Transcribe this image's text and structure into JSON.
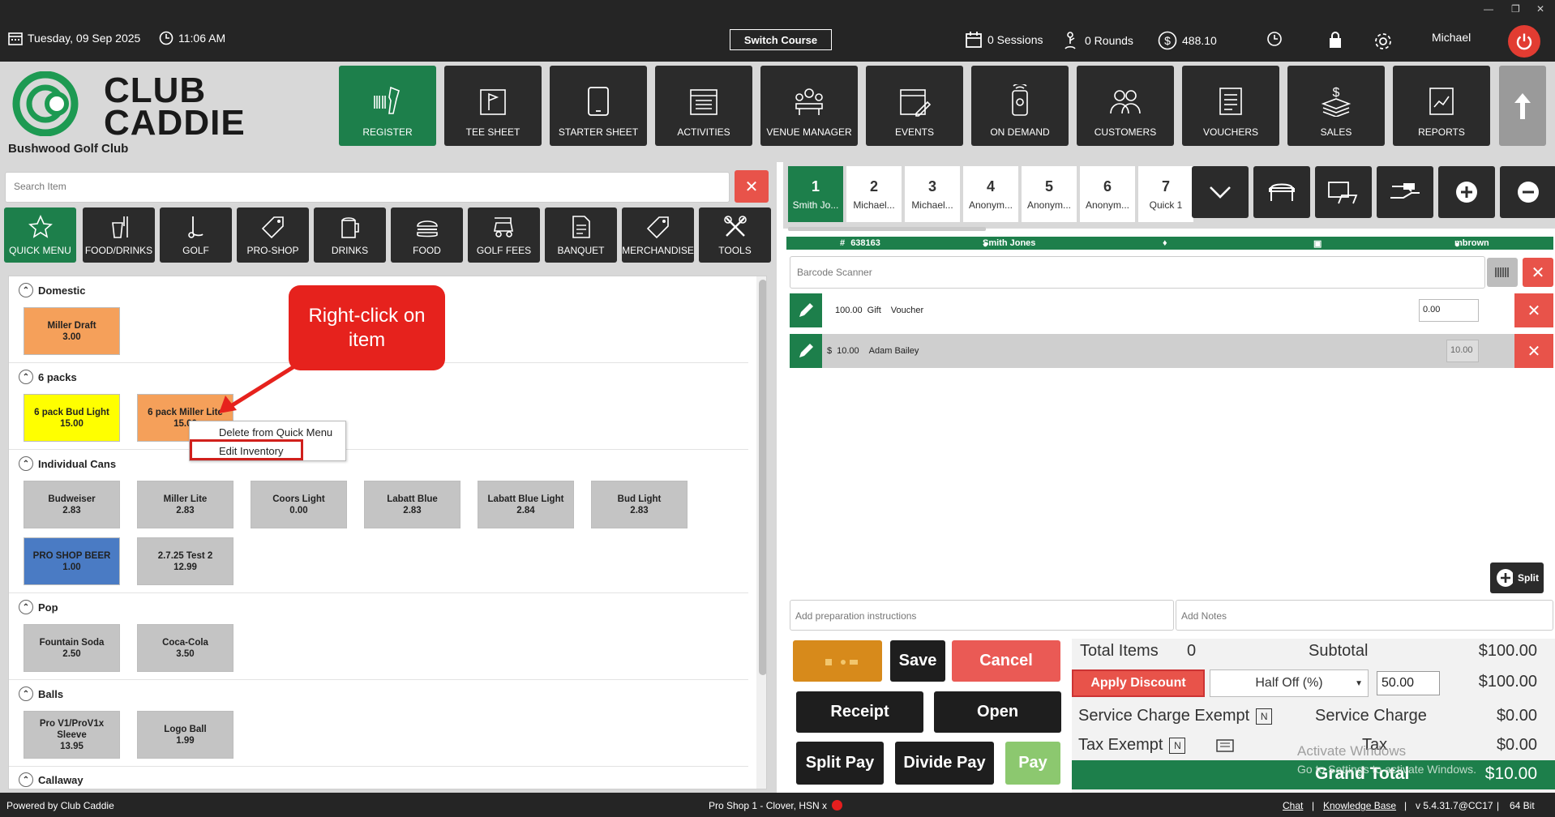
{
  "topbar": {
    "date": "Tuesday,  09 Sep 2025",
    "time": "11:06 AM",
    "switch_course": "Switch Course",
    "sessions": "0 Sessions",
    "rounds": "0 Rounds",
    "balance": "488.10",
    "user": "Michael"
  },
  "brand": {
    "logo_line1": "CLUB",
    "logo_line2": "CADDIE",
    "club_name": "Bushwood Golf Club"
  },
  "nav": [
    "REGISTER",
    "TEE SHEET",
    "STARTER SHEET",
    "ACTIVITIES",
    "VENUE MANAGER",
    "EVENTS",
    "ON DEMAND",
    "CUSTOMERS",
    "VOUCHERS",
    "SALES",
    "REPORTS"
  ],
  "search": {
    "placeholder": "Search Item"
  },
  "categories": [
    "QUICK MENU",
    "FOOD/DRINKS",
    "GOLF",
    "PRO-SHOP",
    "DRINKS",
    "FOOD",
    "GOLF FEES",
    "BANQUET",
    "MERCHANDISE",
    "TOOLS"
  ],
  "sections": {
    "domestic": {
      "title": "Domestic",
      "items": [
        {
          "name": "Miller Draft",
          "price": "3.00",
          "color": "#f5a05a"
        }
      ]
    },
    "six_packs": {
      "title": "6 packs",
      "items": [
        {
          "name": "6 pack Bud Light",
          "price": "15.00",
          "color": "#ffff00"
        },
        {
          "name": "6 pack Miller Lite",
          "price": "15.00",
          "color": "#f5a05a"
        }
      ]
    },
    "cans": {
      "title": "Individual Cans",
      "items": [
        {
          "name": "Budweiser",
          "price": "2.83"
        },
        {
          "name": "Miller Lite",
          "price": "2.83"
        },
        {
          "name": "Coors Light",
          "price": "0.00"
        },
        {
          "name": "Labatt Blue",
          "price": "2.83"
        },
        {
          "name": "Labatt Blue Light",
          "price": "2.84"
        },
        {
          "name": "Bud Light",
          "price": "2.83"
        },
        {
          "name": "PRO SHOP BEER",
          "price": "1.00",
          "color": "#4a7bc4"
        },
        {
          "name": "2.7.25 Test 2",
          "price": "12.99"
        }
      ]
    },
    "pop": {
      "title": "Pop",
      "items": [
        {
          "name": "Fountain Soda",
          "price": "2.50"
        },
        {
          "name": "Coca-Cola",
          "price": "3.50"
        }
      ]
    },
    "balls": {
      "title": "Balls",
      "items": [
        {
          "name": "Pro V1/ProV1x Sleeve",
          "price": "13.95"
        },
        {
          "name": "Logo Ball",
          "price": "1.99"
        }
      ]
    },
    "callaway": {
      "title": "Callaway"
    }
  },
  "annotation": {
    "callout": "Right-click on item"
  },
  "context_menu": {
    "delete": "Delete from Quick Menu",
    "edit": "Edit Inventory"
  },
  "order_tabs": [
    {
      "num": "1",
      "label": "Smith Jo..."
    },
    {
      "num": "2",
      "label": "Michael..."
    },
    {
      "num": "3",
      "label": "Michael..."
    },
    {
      "num": "4",
      "label": "Anonym..."
    },
    {
      "num": "5",
      "label": "Anonym..."
    },
    {
      "num": "6",
      "label": "Anonym..."
    },
    {
      "num": "7",
      "label": "Quick 1"
    }
  ],
  "order_info": {
    "ticket": "638163",
    "customer": "Smith Jones",
    "server": "mbrown"
  },
  "barcode": {
    "placeholder": "Barcode Scanner"
  },
  "lines": [
    {
      "amount": "100.00",
      "type": "Gift",
      "desc": "Voucher",
      "value": "0.00"
    },
    {
      "currency": "$",
      "amount": "10.00",
      "desc": "Adam Bailey",
      "value": "10.00"
    }
  ],
  "split_label": "Split",
  "notes": {
    "prep_placeholder": "Add preparation instructions",
    "notes_placeholder": "Add Notes"
  },
  "actions": {
    "save": "Save",
    "cancel": "Cancel",
    "receipt": "Receipt",
    "open": "Open",
    "split_pay": "Split Pay",
    "divide_pay": "Divide Pay",
    "pay": "Pay"
  },
  "totals": {
    "total_items_label": "Total Items",
    "total_items": "0",
    "subtotal_label": "Subtotal",
    "subtotal": "$100.00",
    "apply_discount": "Apply Discount",
    "discount_type": "Half Off  (%)",
    "discount_value": "50.00",
    "discounted": "$100.00",
    "service_exempt_label": "Service Charge Exempt",
    "service_charge_label": "Service Charge",
    "service_charge": "$0.00",
    "tax_exempt_label": "Tax Exempt",
    "tax_label": "Tax",
    "tax": "$0.00",
    "grand_total_label": "Grand Total",
    "grand_total": "$10.00",
    "checkbox_n": "N"
  },
  "watermark": {
    "line1": "Activate Windows",
    "line2": "Go to Settings to activate Windows."
  },
  "footer": {
    "powered": "Powered by Club Caddie",
    "device": "Pro Shop 1 - Clover, HSN x",
    "chat": "Chat",
    "kb": "Knowledge Base",
    "version": "v 5.4.31.7@CC17",
    "bits": "64 Bit",
    "sep": "|"
  },
  "colors": {
    "brand_green": "#1d7f4b",
    "danger": "#e8534a",
    "dark": "#2b2b2b"
  }
}
